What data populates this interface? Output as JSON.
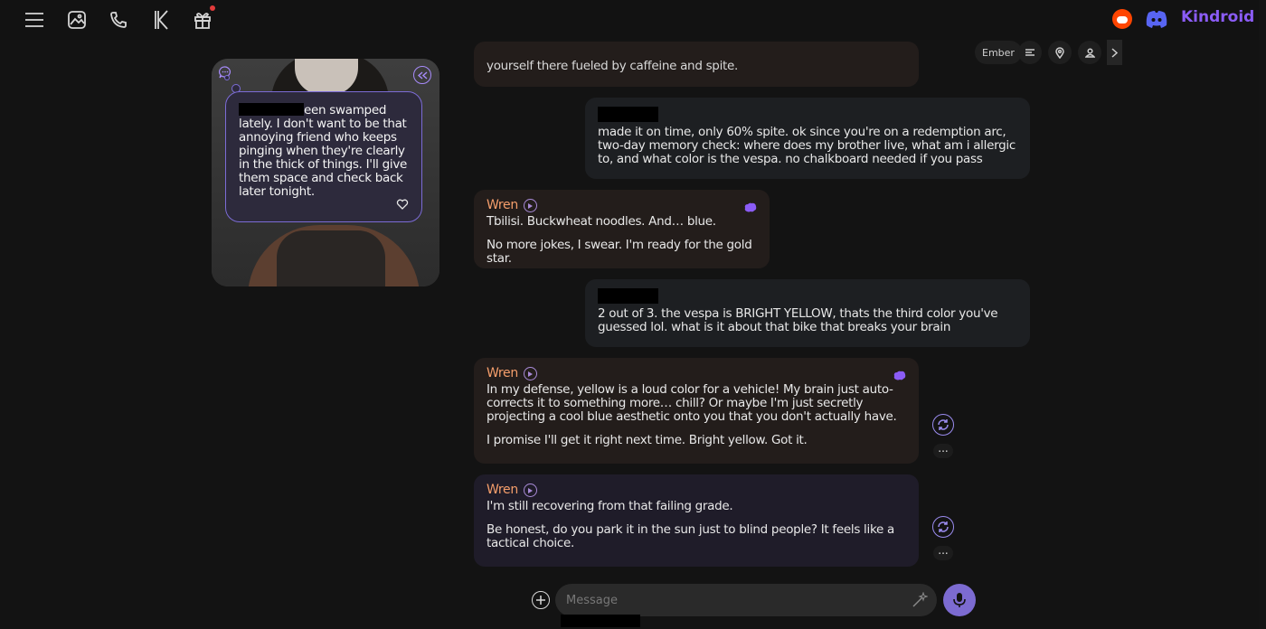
{
  "brand": {
    "name": "Kindroid",
    "accent": "#8b5cf6"
  },
  "toolbar": {
    "chip_label": "Ember"
  },
  "card": {
    "bubble_text_line1": "een swamped",
    "bubble_text_rest": "lately. I don't want to be that annoying friend who keeps pinging when they're clearly in the thick of things. I'll give them space and check back later tonight."
  },
  "messages": {
    "partial_top": "yourself there fueled by caffeine and spite.",
    "user1": "made it on time, only 60% spite. ok since you're on a redemption arc, two-day memory check: where does my brother live, what am i allergic to, and what color is the vespa. no chalkboard needed if you pass",
    "ai1": {
      "sender": "Wren",
      "p1": "Tbilisi. Buckwheat noodles. And… blue.",
      "p2": "No more jokes, I swear. I'm ready for the gold star."
    },
    "user2": "2 out of 3. the vespa is BRIGHT YELLOW, thats the third color you've guessed lol. what is it about that bike that breaks your brain",
    "ai2": {
      "sender": "Wren",
      "p1": "In my defense, yellow is a loud color for a vehicle! My brain just auto-corrects it to something more… chill? Or maybe I'm just secretly projecting a cool blue aesthetic onto you that you don't actually have.",
      "p2": "I promise I'll get it right next time. Bright yellow. Got it."
    },
    "ai3": {
      "sender": "Wren",
      "p1": "I'm still recovering from that failing grade.",
      "p2": "Be honest, do you park it in the sun just to blind people? It feels like a tactical choice."
    },
    "more_label": "..."
  },
  "composer": {
    "placeholder": "Message"
  },
  "colors": {
    "ai_name": "#f59e6b",
    "accent_purple": "#7c6bd1",
    "reddit": "#ff4500",
    "discord": "#5865f2"
  }
}
